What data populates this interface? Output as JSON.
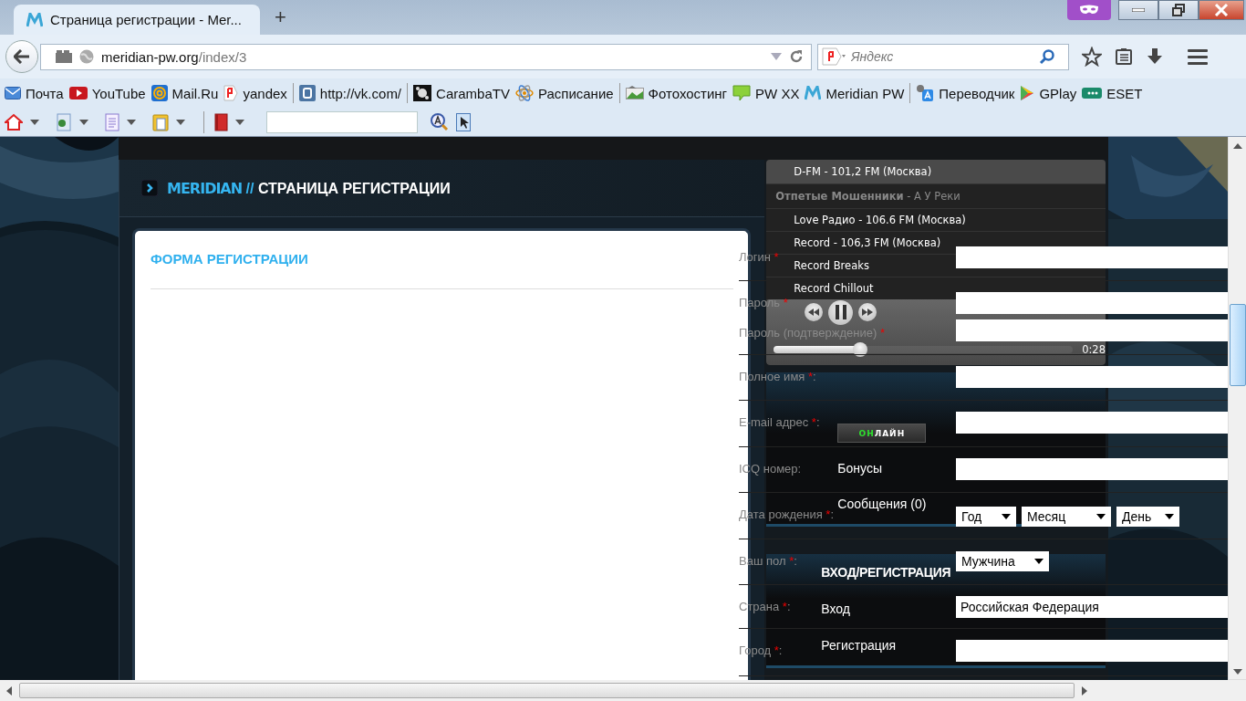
{
  "browser": {
    "tab": {
      "title": "Страница регистрации - Mer..."
    },
    "new_tab": "+",
    "url_host": "meridian-pw.org",
    "url_path": "/index/3",
    "search": {
      "placeholder": "Яндекс"
    }
  },
  "bookmarks": [
    {
      "label": "Почта",
      "separator_after": false
    },
    {
      "label": "YouTube",
      "separator_after": false
    },
    {
      "label": "Mail.Ru",
      "separator_after": false
    },
    {
      "label": "yandex",
      "separator_after": true
    },
    {
      "label": "http://vk.com/",
      "separator_after": true
    },
    {
      "label": "CarambaTV",
      "separator_after": false
    },
    {
      "label": "Расписание",
      "separator_after": true
    },
    {
      "label": "Фотохостинг",
      "separator_after": false
    },
    {
      "label": "PW XX",
      "separator_after": false
    },
    {
      "label": "Meridian PW",
      "separator_after": true
    },
    {
      "label": "Переводчик",
      "separator_after": false
    },
    {
      "label": "GPlay",
      "separator_after": false
    },
    {
      "label": "ESET",
      "separator_after": false
    }
  ],
  "page": {
    "breadcrumb": {
      "site": "MERIDIAN",
      "sep": "//",
      "current": "СТРАНИЦА РЕГИСТРАЦИИ"
    },
    "form_title": "ФОРМА РЕГИСТРАЦИИ"
  },
  "player": {
    "stations": [
      {
        "kind": "station",
        "label": "D-FM - 101,2 FM (Москва)",
        "selected": true
      },
      {
        "kind": "now_playing",
        "artist": "Отпетые Мошенники",
        "track": "- А У Реки"
      },
      {
        "kind": "station",
        "label": "Love Радио - 106.6 FM (Москва)",
        "selected": false
      },
      {
        "kind": "station",
        "label": "Record - 106,3 FM (Москва)",
        "selected": false
      },
      {
        "kind": "station",
        "label": "Record Breaks",
        "selected": false
      },
      {
        "kind": "station",
        "label": "Record Chillout",
        "selected": false
      }
    ],
    "playing": true,
    "level": 0.29,
    "time": "0:28"
  },
  "sidebar": {
    "online": {
      "lead": "ОН",
      "rest": "ЛАЙН"
    },
    "items": [
      {
        "kind": "link",
        "label": "Бонусы"
      },
      {
        "kind": "link",
        "label": "Сообщения (0)"
      },
      {
        "kind": "heading",
        "label": "ВХОД/РЕГИСТРАЦИЯ"
      },
      {
        "kind": "link",
        "label": "Вход"
      },
      {
        "kind": "link",
        "label": "Регистрация"
      }
    ]
  },
  "form": [
    {
      "kind": "text",
      "label": "Логин",
      "mark": "*"
    },
    {
      "kind": "text",
      "label": "Пароль",
      "mark": "*"
    },
    {
      "kind": "text",
      "label": "Пароль (подтверждение)",
      "mark": "*"
    },
    {
      "kind": "text",
      "label": "Полное имя",
      "mark": "*",
      "suffix": ":"
    },
    {
      "kind": "text",
      "label": "E-mail адрес",
      "mark": "*",
      "suffix": ":"
    },
    {
      "kind": "text",
      "label": "ICQ номер",
      "suffix": ":"
    },
    {
      "kind": "date",
      "label": "Дата рождения",
      "mark": "*",
      "suffix": ":",
      "selects": [
        "Год",
        "Месяц",
        "День"
      ]
    },
    {
      "kind": "select",
      "label": "Ваш пол",
      "mark": "*",
      "suffix": ":",
      "value": "Мужчина"
    },
    {
      "kind": "text",
      "label": "Страна",
      "mark": "*",
      "suffix": ":",
      "value": "Российская Федерация"
    },
    {
      "kind": "text",
      "label": "Город",
      "mark": "*",
      "suffix": ":"
    }
  ]
}
